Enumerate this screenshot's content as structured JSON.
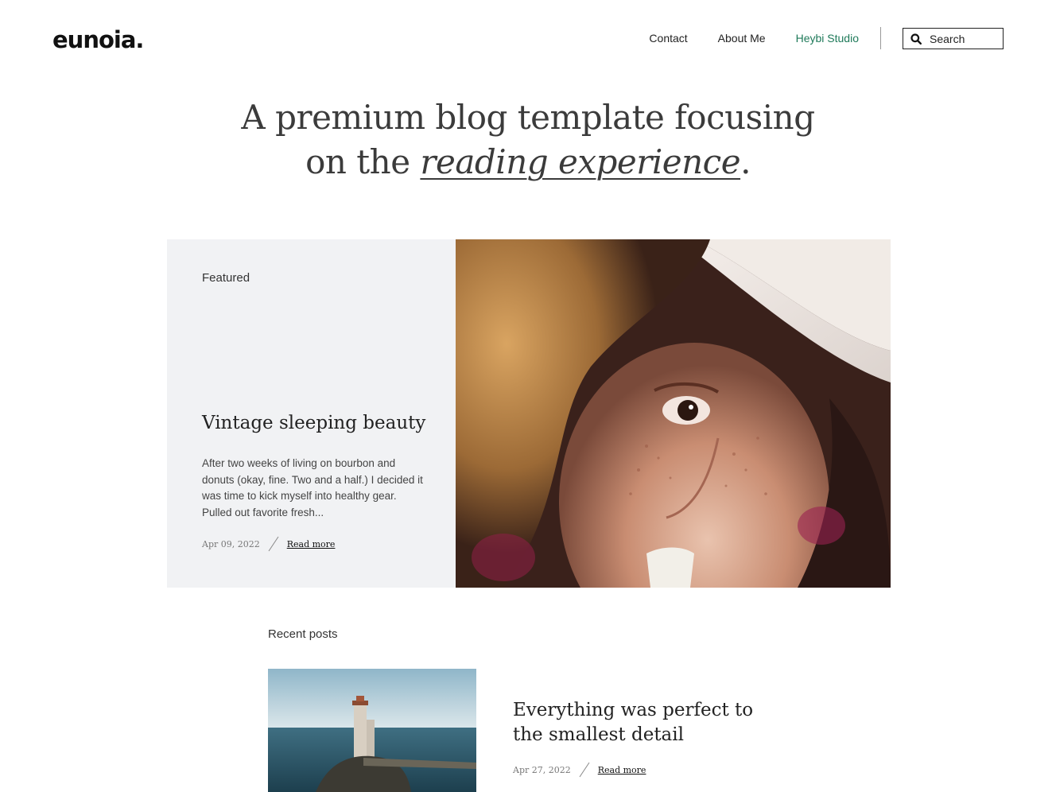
{
  "brand": {
    "logo_text": "eunoia."
  },
  "nav": {
    "items": [
      {
        "label": "Contact"
      },
      {
        "label": "About Me"
      },
      {
        "label": "Heybi Studio"
      }
    ]
  },
  "search": {
    "label": "Search"
  },
  "hero": {
    "line1": "A premium blog template focusing",
    "line2_prefix": "on the ",
    "line2_emphasis": "reading experience",
    "line2_suffix": "."
  },
  "featured": {
    "label": "Featured",
    "title": "Vintage sleeping beauty",
    "excerpt": "After two weeks of living on bourbon and donuts (okay, fine. Two and a half.) I decided it was time to kick myself into healthy gear. Pulled out favorite fresh...",
    "date": "Apr 09, 2022",
    "read_more": "Read more"
  },
  "recent": {
    "label": "Recent posts",
    "posts": [
      {
        "title": "Everything was perfect to the smallest detail",
        "date": "Apr 27, 2022",
        "read_more": "Read more"
      }
    ]
  },
  "colors": {
    "accent": "#1f7a5a",
    "featured_bg": "#f1f2f4",
    "text": "#222222"
  },
  "icons": {
    "search": "search-icon"
  }
}
